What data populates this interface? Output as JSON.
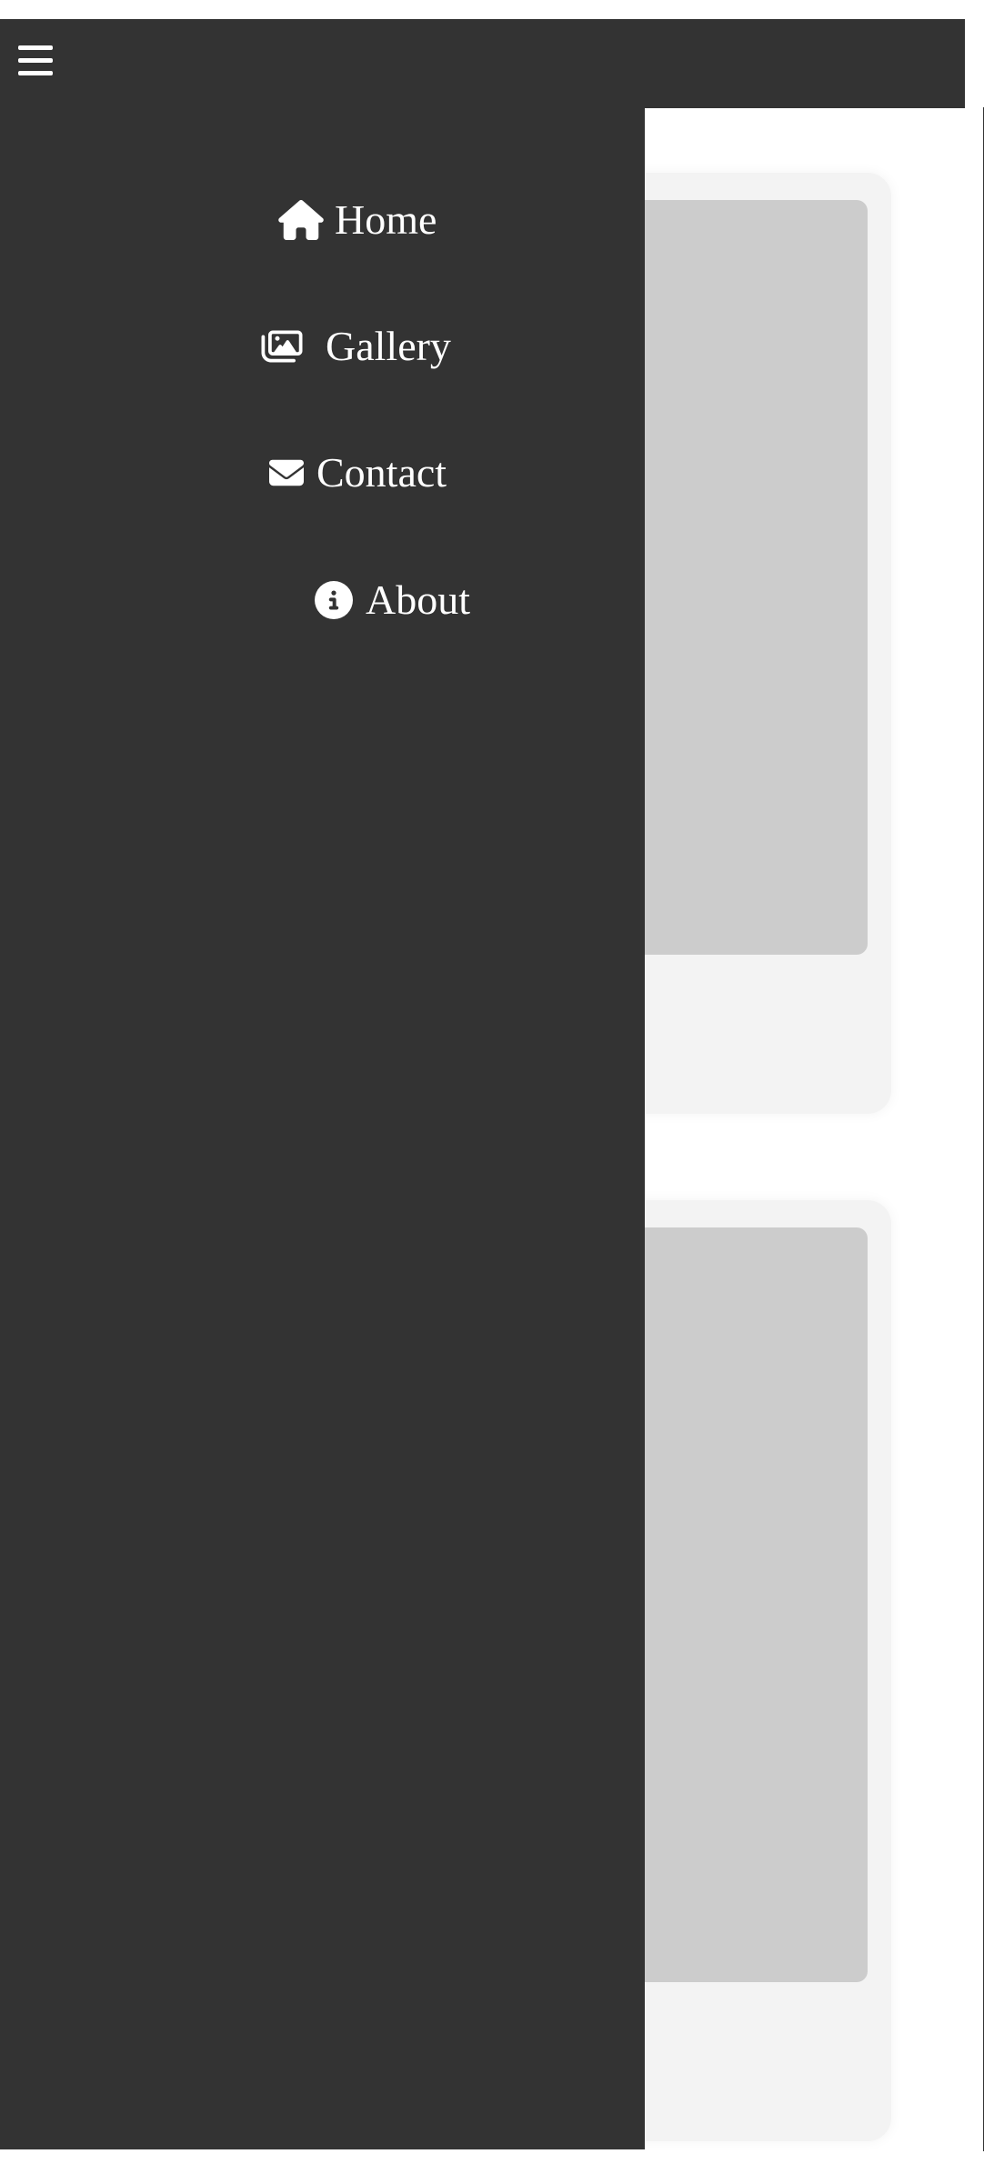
{
  "header": {
    "menu_icon": "hamburger-menu-icon"
  },
  "drawer": {
    "items": [
      {
        "label": "Home",
        "icon": "home-icon"
      },
      {
        "label": "Gallery",
        "icon": "images-icon"
      },
      {
        "label": "Contact",
        "icon": "envelope-icon"
      },
      {
        "label": "About",
        "icon": "info-circle-icon"
      }
    ]
  },
  "cards": [
    {
      "image": "placeholder-image"
    },
    {
      "image": "placeholder-image"
    }
  ],
  "colors": {
    "header_bg": "#333333",
    "drawer_bg": "#333333",
    "drawer_text": "#ffffff",
    "card_bg": "#f3f3f3",
    "image_placeholder": "#cccccc"
  }
}
